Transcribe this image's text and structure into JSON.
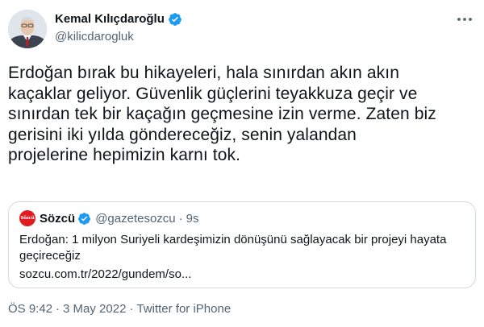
{
  "author": {
    "display_name": "Kemal Kılıçdaroğlu",
    "handle": "@kilicdarogluk",
    "verified": true
  },
  "tweet": {
    "text": "Erdoğan bırak bu hikayeleri, hala sınırdan akın akın\nkaçaklar geliyor. Güvenlik güçlerini teyakkuza geçir ve\nsınırdan tek bir kaçağın geçmesine izin verme. Zaten biz\ngerisini iki yılda göndereceğiz, senin yalandan\nprojelerine hepimizin karnı tok."
  },
  "quoted_tweet": {
    "logo_text": "Sözcü",
    "name": "Sözcü",
    "handle": "@gazetesozcu",
    "separator": "·",
    "time": "9s",
    "text": "Erdoğan: 1 milyon Suriyeli kardeşimizin dönüşünü sağlayacak bir projeyi hayata geçireceğiz",
    "link": "sozcu.com.tr/2022/gundem/so..."
  },
  "meta": {
    "time": "ÖS 9:42",
    "separator": "·",
    "date": "3 May 2022",
    "source": "Twitter for iPhone"
  },
  "colors": {
    "verified": "#1d9bf0",
    "brand_red": "#e11b22",
    "secondary_text": "#536471",
    "border": "#cfd9de"
  },
  "icons": {
    "verified": "verified-badge-icon",
    "more": "more-options-icon"
  }
}
